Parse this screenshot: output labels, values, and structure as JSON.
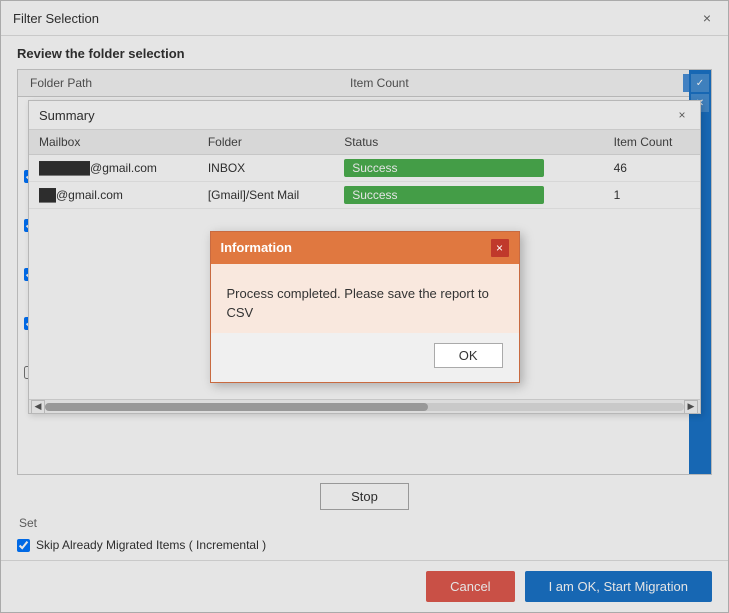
{
  "window": {
    "title": "Filter Selection",
    "close_label": "×"
  },
  "section": {
    "review_label": "Review the folder selection"
  },
  "folder_table": {
    "col_folder_path": "Folder Path",
    "col_item_count": "Item Count"
  },
  "summary_dialog": {
    "title": "Summary",
    "close_label": "×",
    "table": {
      "headers": [
        "Mailbox",
        "Folder",
        "Status",
        "Item Count"
      ],
      "rows": [
        {
          "mailbox": "██████@gmail.com",
          "folder": "INBOX",
          "status": "Success",
          "item_count": "46"
        },
        {
          "mailbox": "██@gmail.com",
          "folder": "[Gmail]/Sent Mail",
          "status": "Success",
          "item_count": "1"
        }
      ]
    }
  },
  "info_dialog": {
    "title": "Information",
    "close_label": "×",
    "message": "Process completed. Please save the report to CSV",
    "ok_label": "OK"
  },
  "bottom": {
    "stop_label": "Stop",
    "checkbox_label": "Skip Already Migrated Items ( Incremental )",
    "set_label": "Set"
  },
  "footer": {
    "cancel_label": "Cancel",
    "start_label": "I am OK, Start Migration"
  },
  "colors": {
    "accent": "#1a73c8",
    "success": "#4caf50",
    "info_header": "#e07840",
    "cancel": "#e05a4e"
  }
}
